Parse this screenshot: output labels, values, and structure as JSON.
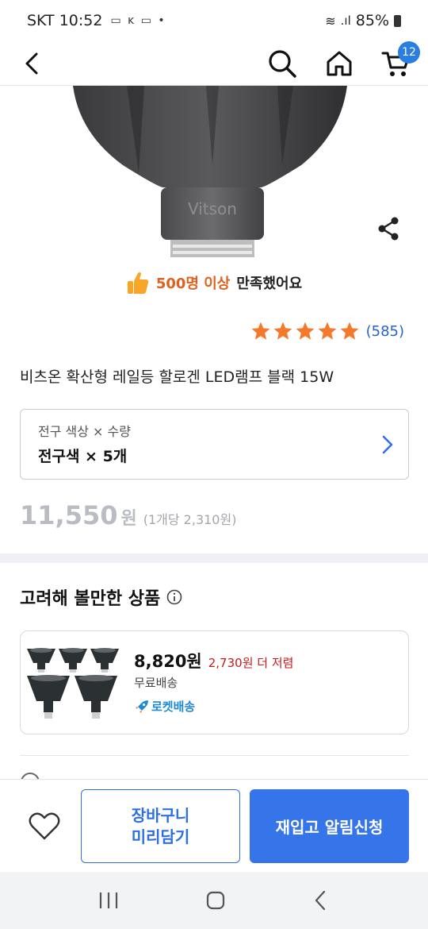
{
  "status": {
    "carrier_time": "SKT 10:52",
    "battery": "85%"
  },
  "nav": {
    "cart_count": "12"
  },
  "product_image": {
    "brand_text": "Vitson"
  },
  "satisfaction": {
    "count_text": "500명 이상",
    "text": "만족했어요"
  },
  "rating": {
    "stars": 5,
    "count": "(585)"
  },
  "product": {
    "title": "비츠온 확산형 레일등 할로겐 LED램프 블랙 15W"
  },
  "option": {
    "label": "전구 색상 × 수량",
    "value": "전구색 × 5개"
  },
  "price": {
    "amount": "11,550",
    "won": "원",
    "unit_price": "(1개당 2,310원)"
  },
  "recommend": {
    "title": "고려해 볼만한 상품",
    "item": {
      "price": "8,820원",
      "discount": "2,730원 더 저렴",
      "shipping": "무료배송",
      "rocket": "로켓배송"
    }
  },
  "bottom": {
    "cart_line1": "장바구니",
    "cart_line2": "미리담기",
    "restock": "재입고 알림신청"
  },
  "colors": {
    "accent_blue": "#3674ea",
    "rating_star": "#f4792b",
    "discount_red": "#c81a1a",
    "rocket_blue": "#1d8ad6"
  }
}
